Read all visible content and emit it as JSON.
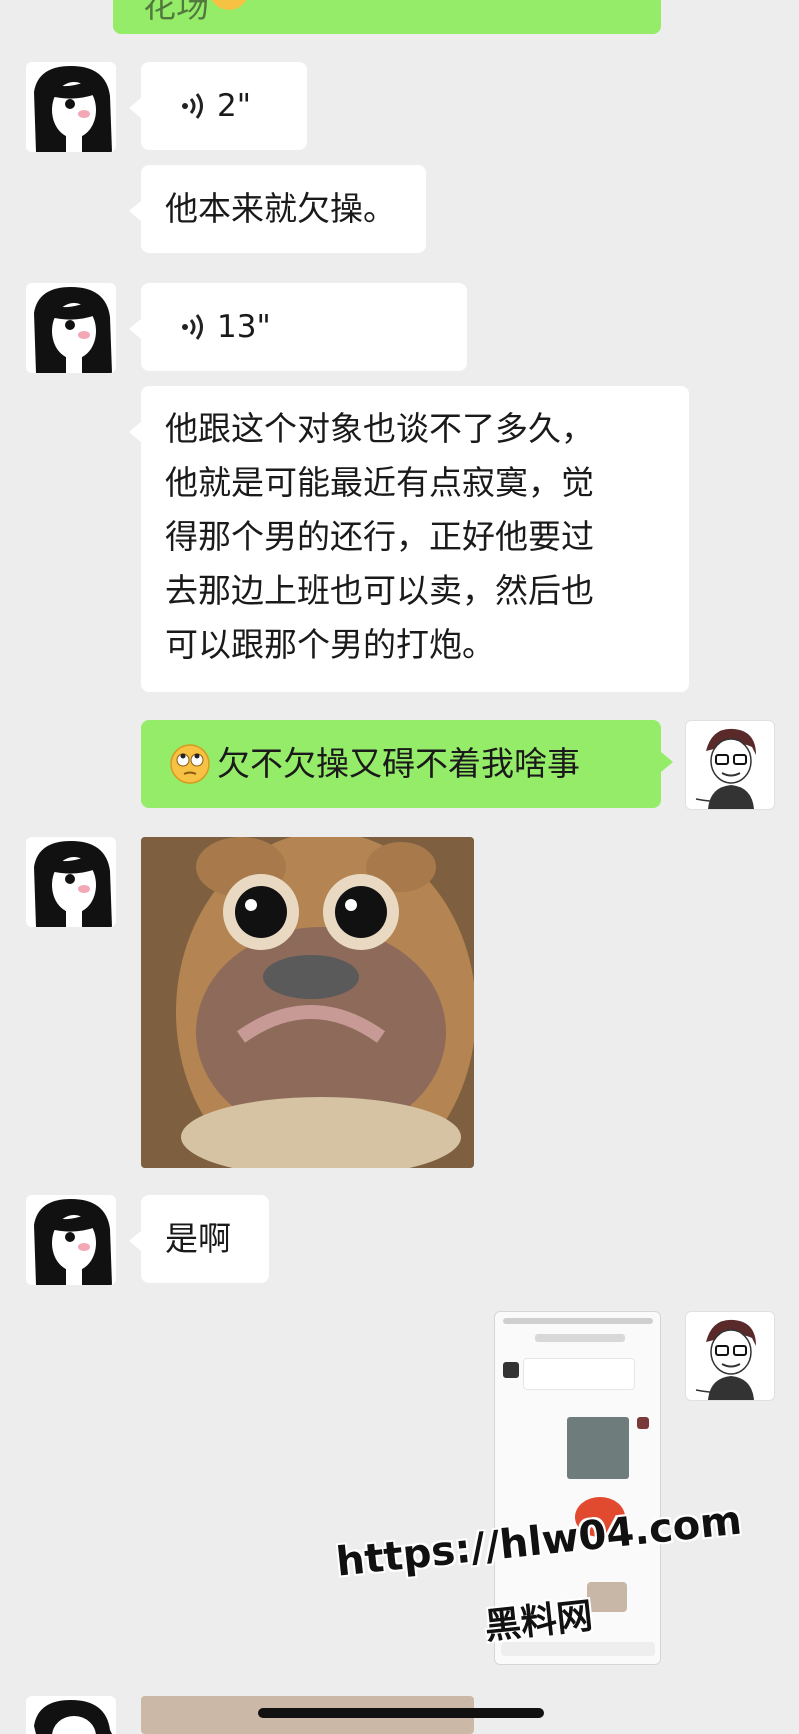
{
  "messages": {
    "partial_top_text": "花场",
    "voice1_duration": "2\"",
    "text1": "他本来就欠操。",
    "voice2_duration": "13\"",
    "text2_lines": [
      "他跟这个对象也谈不了多久，",
      "他就是可能最近有点寂寞，觉",
      "得那个男的还行，正好他要过",
      "去那边上班也可以卖，然后也",
      "可以跟那个男的打炮。"
    ],
    "reply1": "欠不欠操又碍不着我啥事",
    "text3": "是啊"
  },
  "watermark": {
    "url": "https://hlw04.com",
    "name": "黑料网"
  },
  "colors": {
    "background": "#ededed",
    "incoming_bubble": "#ffffff",
    "outgoing_bubble": "#95ec69"
  },
  "icons": {
    "voice": "voice-wave-icon",
    "emoji": "rolling-eyes-emoji-icon"
  }
}
